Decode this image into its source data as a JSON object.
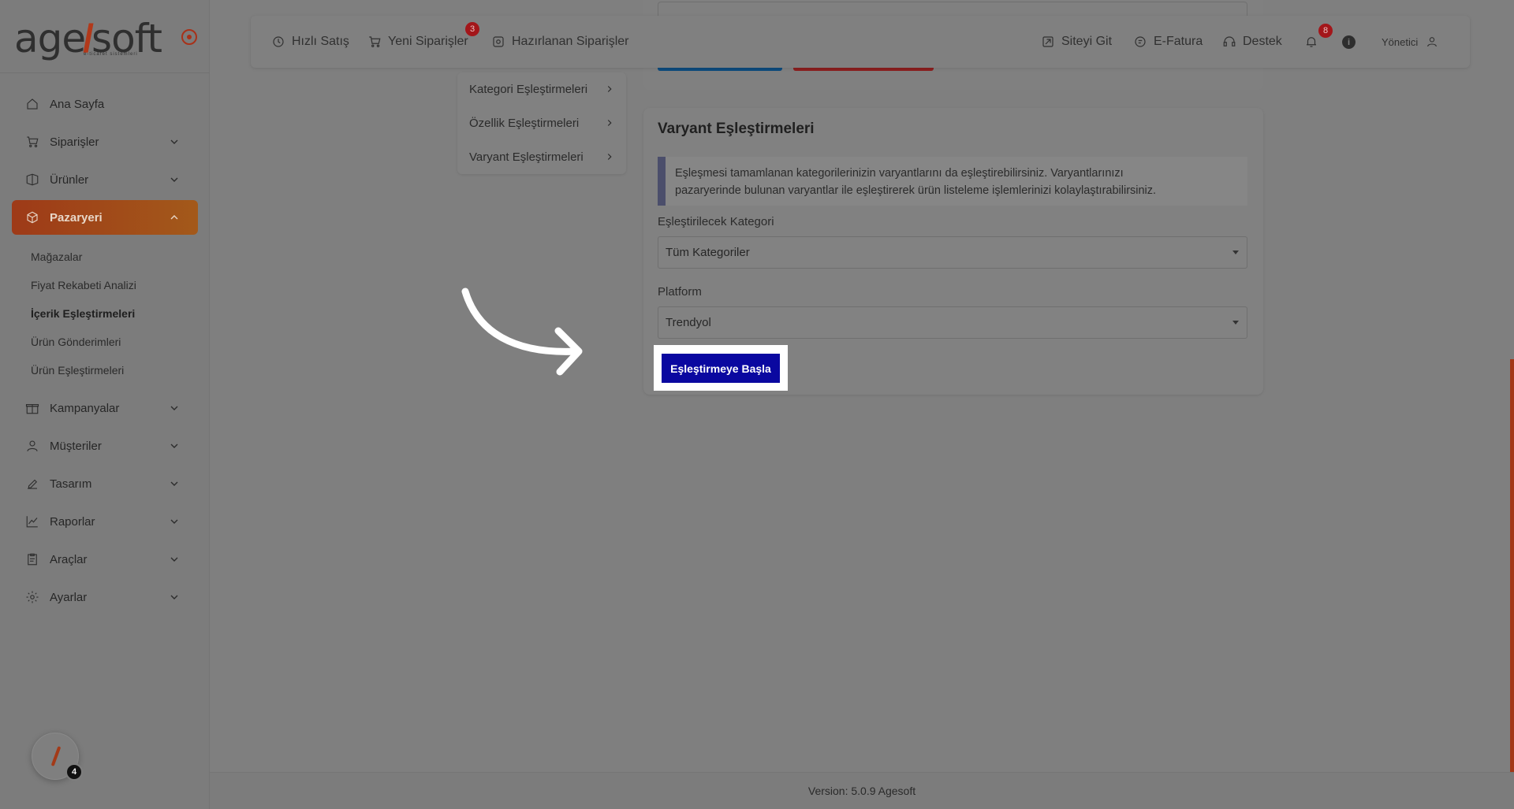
{
  "brand": {
    "name_part1": "age",
    "name_part2": "soft",
    "tagline": "e-ticaret sistemleri",
    "accent": "#a3391a"
  },
  "sidebar": {
    "items": [
      {
        "label": "Ana Sayfa",
        "icon": "home-icon"
      },
      {
        "label": "Siparişler",
        "icon": "cart-icon"
      },
      {
        "label": "Ürünler",
        "icon": "box-icon"
      },
      {
        "label": "Pazaryeri",
        "icon": "cube-icon",
        "active": true
      },
      {
        "label": "Kampanyalar",
        "icon": "gift-icon"
      },
      {
        "label": "Müşteriler",
        "icon": "user-icon"
      },
      {
        "label": "Tasarım",
        "icon": "edit-icon"
      },
      {
        "label": "Raporlar",
        "icon": "chart-icon"
      },
      {
        "label": "Araçlar",
        "icon": "clipboard-icon"
      },
      {
        "label": "Ayarlar",
        "icon": "gear-icon"
      }
    ],
    "subitems": [
      {
        "label": "Mağazalar"
      },
      {
        "label": "Fiyat Rekabeti Analizi"
      },
      {
        "label": "İçerik Eşleştirmeleri",
        "current": true
      },
      {
        "label": "Ürün Gönderimleri"
      },
      {
        "label": "Ürün Eşleştirmeleri"
      }
    ],
    "helper_count": "4"
  },
  "topbar": {
    "quick_sale": "Hızlı Satış",
    "new_orders": "Yeni Siparişler",
    "new_orders_badge": "3",
    "prepared_orders": "Hazırlanan Siparişler",
    "go_site": "Siteyi Git",
    "e_invoice": "E-Fatura",
    "support": "Destek",
    "notifications_badge": "8",
    "info": "i",
    "user": "Yönetici"
  },
  "submenu": {
    "items": [
      {
        "label": "Kategori Eşleştirmeleri"
      },
      {
        "label": "Özellik Eşleştirmeleri"
      },
      {
        "label": "Varyant Eşleştirmeleri"
      }
    ]
  },
  "variant_card": {
    "title": "Varyant Eşleştirmeleri",
    "alert_line1": "Eşleşmesi tamamlanan kategorilerinizin varyantlarını da eşleştirebilirsiniz. Varyantlarınızı",
    "alert_line2": "pazaryerinde bulunan varyantlar ile eşleştirerek ürün listeleme işlemlerinizi kolaylaştırabilirsiniz.",
    "category_label": "Eşleştirilecek Kategori",
    "category_value": "Tüm Kategoriler",
    "platform_label": "Platform",
    "platform_value": "Trendyol",
    "start_button": "Eşleştirmeye Başla"
  },
  "footer": {
    "version": "Version: 5.0.9 Agesoft"
  }
}
